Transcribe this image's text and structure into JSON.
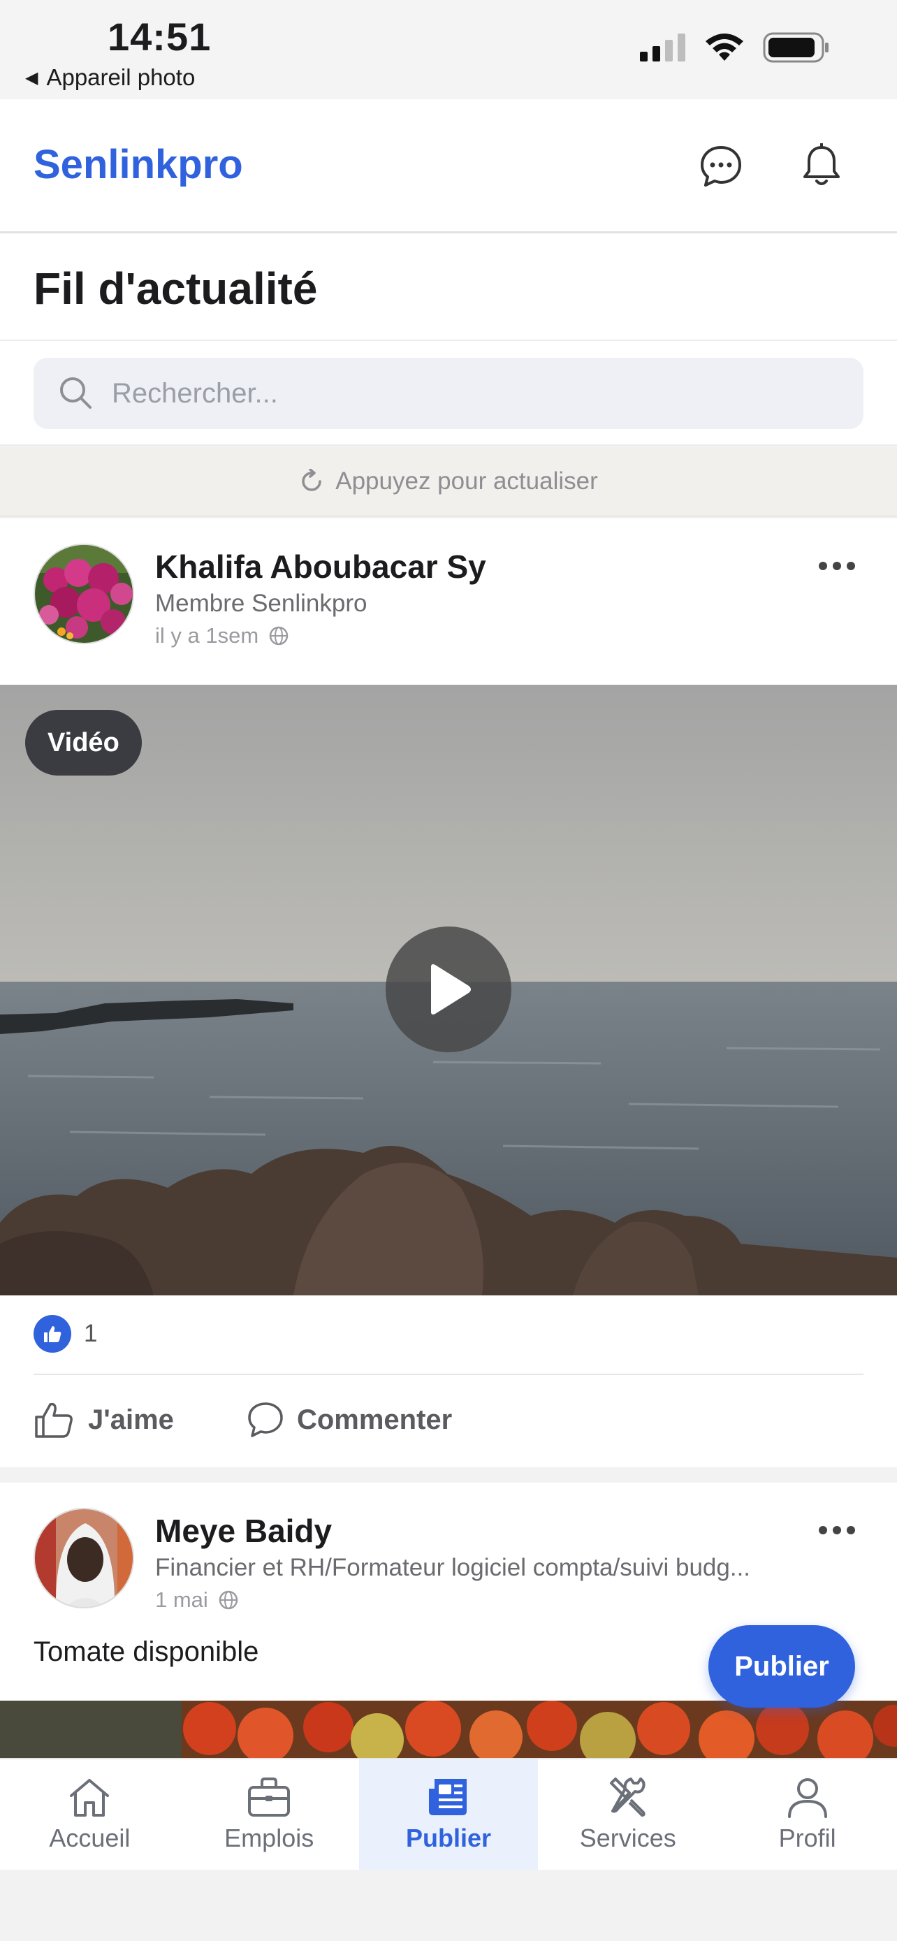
{
  "status_bar": {
    "time": "14:51",
    "back_label": "Appareil photo"
  },
  "header": {
    "brand": "Senlinkpro",
    "messages_icon": "chat-bubble-icon",
    "notifications_icon": "bell-icon"
  },
  "page": {
    "title": "Fil d'actualité"
  },
  "search": {
    "placeholder": "Rechercher..."
  },
  "refresh": {
    "label": "Appuyez pour actualiser"
  },
  "posts": [
    {
      "author": "Khalifa Aboubacar Sy",
      "role": "Membre Senlinkpro",
      "time": "il y a 1sem",
      "media_badge": "Vidéo",
      "likes": "1",
      "like_label": "J'aime",
      "comment_label": "Commenter"
    },
    {
      "author": "Meye Baidy",
      "role": "Financier et RH/Formateur logiciel compta/suivi budg...",
      "time": "1 mai",
      "text": "Tomate disponible"
    }
  ],
  "fab": {
    "label": "Publier"
  },
  "nav": [
    {
      "label": "Accueil",
      "icon": "home-icon"
    },
    {
      "label": "Emplois",
      "icon": "briefcase-icon"
    },
    {
      "label": "Publier",
      "icon": "newspaper-icon",
      "active": true
    },
    {
      "label": "Services",
      "icon": "tools-icon"
    },
    {
      "label": "Profil",
      "icon": "person-icon"
    }
  ],
  "colors": {
    "accent": "#2f62dc",
    "active_nav_bg": "#eaf1fd"
  }
}
